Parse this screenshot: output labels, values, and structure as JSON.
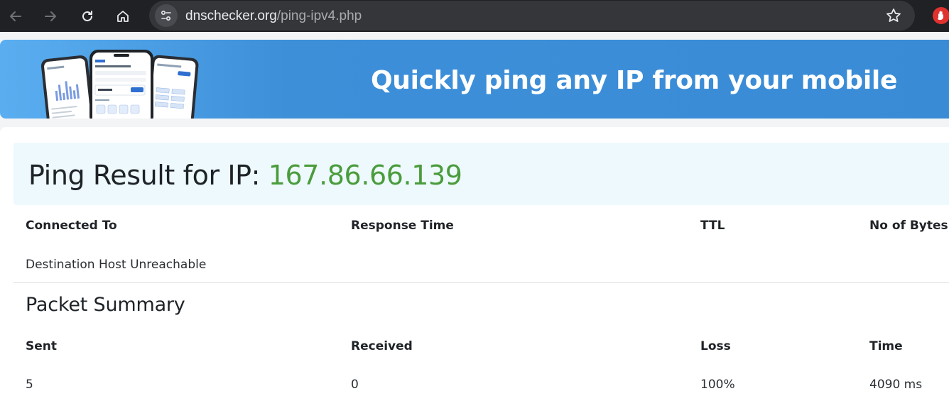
{
  "browser": {
    "url_host": "dnschecker.org",
    "url_path": "/ping-ipv4.php"
  },
  "banner": {
    "title": "Quickly ping any IP from your mobile"
  },
  "result": {
    "title_prefix": "Ping Result for IP: ",
    "ip": "167.86.66.139",
    "columns": [
      "Connected To",
      "Response Time",
      "TTL",
      "No of Bytes"
    ],
    "rows": [
      [
        "Destination Host Unreachable",
        "",
        "",
        ""
      ]
    ]
  },
  "summary": {
    "title": "Packet Summary",
    "columns": [
      "Sent",
      "Received",
      "Loss",
      "Time"
    ],
    "values": [
      "5",
      "0",
      "100%",
      "4090 ms"
    ]
  },
  "colors": {
    "ip_green": "#4a9c3c",
    "banner_blue": "#3a8bd6"
  }
}
